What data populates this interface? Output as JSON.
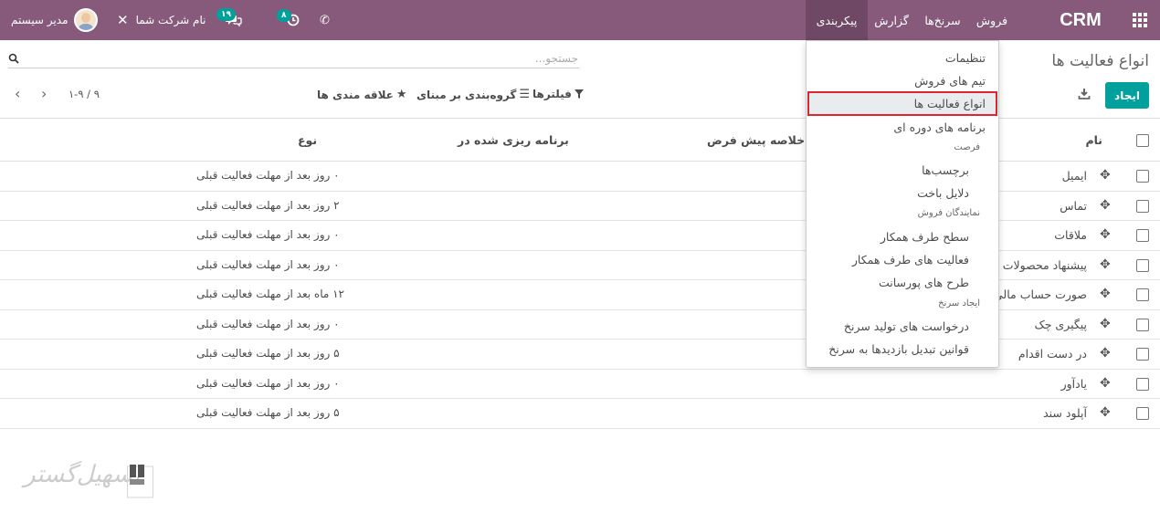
{
  "navbar": {
    "brand": "CRM",
    "menus": [
      "فروش",
      "سرنخ‌ها",
      "گزارش",
      "پیکربندی"
    ],
    "user_name": "مدیر سیستم",
    "company_name": "نام شرکت شما",
    "chat_badge": "۱۹",
    "activity_badge": "۸",
    "color": "#875a7b"
  },
  "control_panel": {
    "title": "انواع فعالیت ها",
    "search_placeholder": "جستجو...",
    "create_label": "ایجاد",
    "filters_label": "فیلترها",
    "groupby_label": "گروه‌بندی بر مبنای",
    "favorites_label": "علاقه مندی ها",
    "pager_value": "۱-۹ / ۹",
    "accent": "#00a09d"
  },
  "table": {
    "headers": {
      "name": "نام",
      "summary": "خلاصه پیش فرض",
      "planned": "برنامه ریزی شده در",
      "type": "نوع"
    },
    "rows": [
      {
        "name": "ایمیل",
        "delay": "۰ روز  بعد از مهلت فعالیت قبلی"
      },
      {
        "name": "تماس",
        "delay": "۲ روز  بعد از مهلت فعالیت قبلی"
      },
      {
        "name": "ملاقات",
        "delay": "۰ روز  بعد از مهلت فعالیت قبلی"
      },
      {
        "name": "پیشنهاد محصولات ج",
        "delay": "۰ روز  بعد از مهلت فعالیت قبلی"
      },
      {
        "name": "صورت حساب مالی",
        "delay": "۱۲ ماه  بعد از مهلت فعالیت قبلی"
      },
      {
        "name": "پیگیری چک",
        "delay": "۰ روز  بعد از مهلت فعالیت قبلی"
      },
      {
        "name": "در دست اقدام",
        "delay": "۵ روز  بعد از مهلت فعالیت قبلی"
      },
      {
        "name": "یادآور",
        "delay": "۰ روز  بعد از مهلت فعالیت قبلی"
      },
      {
        "name": "آپلود سند",
        "delay": "۵ روز  بعد از مهلت فعالیت قبلی"
      }
    ]
  },
  "dropdown": {
    "settings": "تنظیمات",
    "sales_teams": "تیم های فروش",
    "activity_types": "انواع فعالیت ها",
    "recurring_plans": "برنامه های دوره ای",
    "opportunity_header": "فرصت",
    "tags": "برچسب‌ها",
    "lost_reasons": "دلایل باخت",
    "sales_reps_header": "نمایندگان فروش",
    "partner_levels": "سطح طرف همکار",
    "partner_activities": "فعالیت های طرف همکار",
    "survey_designs": "طرح های پورسانت",
    "lead_generation_header": "ایجاد سرنخ",
    "lead_mining_requests": "درخواست های تولید سرنخ",
    "visitor_to_lead_rules": "قوانین تبدیل بازدیدها به سرنخ"
  },
  "watermark": {
    "text": "تسهیل‌گستر"
  }
}
